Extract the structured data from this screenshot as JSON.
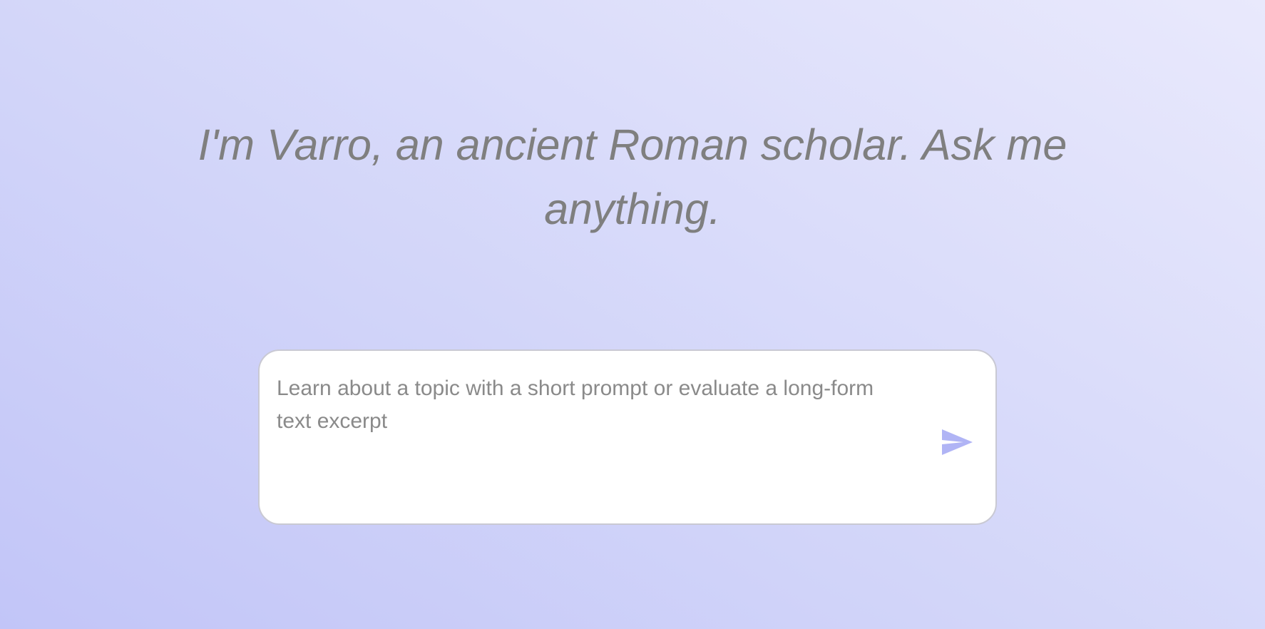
{
  "headline": {
    "text": "I'm Varro, an ancient Roman scholar. Ask me anything."
  },
  "composer": {
    "input_value": "",
    "placeholder": "Learn about a topic with a short prompt or evaluate a long-form text excerpt",
    "send_icon": "send-icon",
    "send_icon_color": "#b0b4f5"
  },
  "colors": {
    "background_start": "#c2c5f8",
    "background_end": "#e9e9fc",
    "headline_text": "#7f7f7f",
    "placeholder_text": "#8a8a8a"
  }
}
